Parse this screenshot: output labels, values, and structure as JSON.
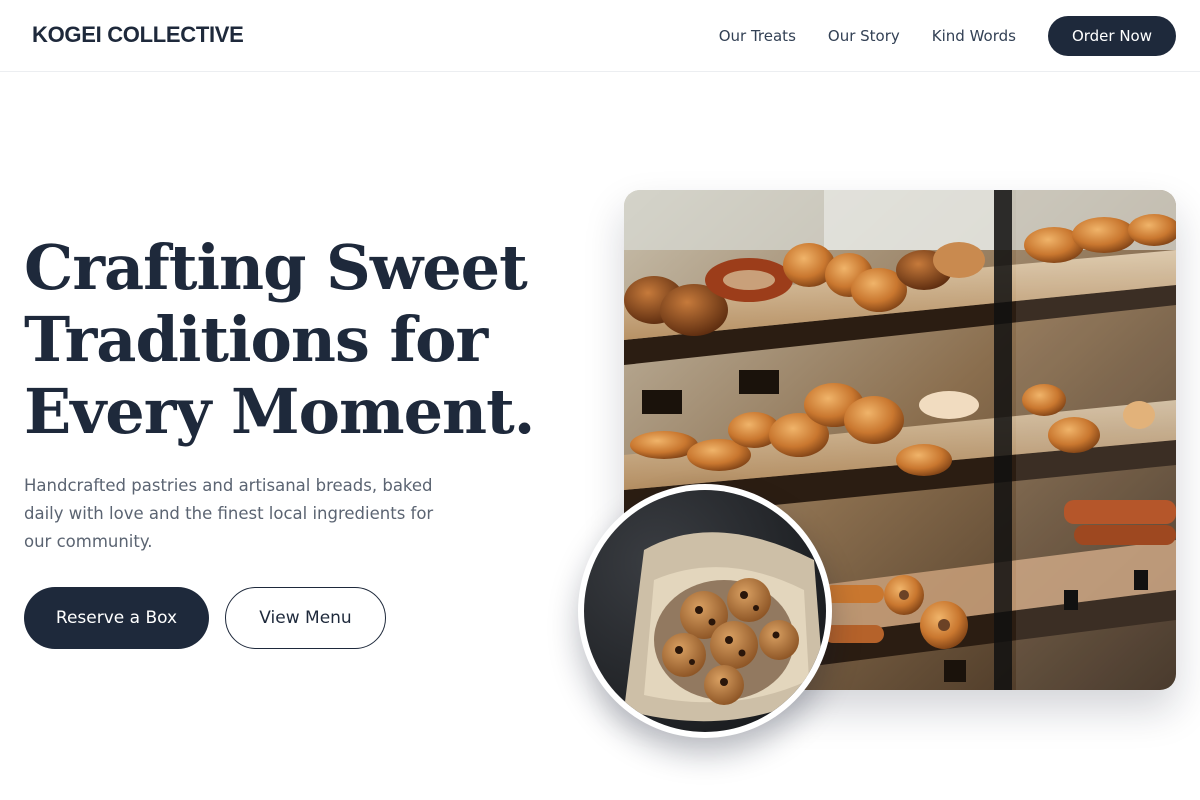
{
  "header": {
    "brand": "KOGEI COLLECTIVE",
    "nav": [
      {
        "label": "Our Treats"
      },
      {
        "label": "Our Story"
      },
      {
        "label": "Kind Words"
      }
    ],
    "cta_label": "Order Now"
  },
  "hero": {
    "headline_lines": [
      "Crafting Sweet",
      "Traditions for",
      "Every Moment."
    ],
    "subtext": "Handcrafted pastries and artisanal breads, baked daily with love and the finest local ingredients for our community.",
    "primary_button": "Reserve a Box",
    "secondary_button": "View Menu"
  },
  "images": {
    "main": "bakery display case with breads and croissants",
    "inset": "basket of chocolate chip cookies"
  },
  "colors": {
    "primary": "#1e293b",
    "body_text": "#5b6472",
    "background": "#ffffff"
  }
}
